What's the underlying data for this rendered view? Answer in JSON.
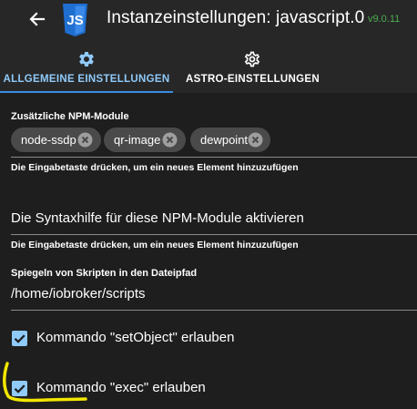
{
  "header": {
    "title": "Instanzeinstellungen: javascript.0",
    "version": "v9.0.11",
    "logo_text": "JS"
  },
  "icons": {
    "back": "arrow-left-icon",
    "logo": "javascript-logo-icon",
    "tab_general": "gear-icon",
    "tab_astro": "gear-outline-icon",
    "chip_delete": "cancel-circle-icon",
    "checkbox": "checkmark-icon"
  },
  "tabs": [
    {
      "label": "ALLGEMEINE EINSTELLUNGEN",
      "active": true
    },
    {
      "label": "ASTRO-EINSTELLUNGEN",
      "active": false
    }
  ],
  "npm": {
    "label": "Zusätzliche NPM-Module",
    "chips": [
      {
        "label": "node-ssdp"
      },
      {
        "label": "qr-image"
      },
      {
        "label": "dewpoint"
      }
    ],
    "helper": "Die Eingabetaste drücken, um ein neues Element hinzuzufügen"
  },
  "syntax": {
    "placeholder": "Die Syntaxhilfe für diese NPM-Module aktivieren",
    "helper": "Die Eingabetaste drücken, um ein neues Element hinzuzufügen"
  },
  "mirror": {
    "label": "Spiegeln von Skripten in den Dateipfad",
    "value": "/home/iobroker/scripts"
  },
  "checkboxes": [
    {
      "label": "Kommando \"setObject\" erlauben",
      "checked": true
    },
    {
      "label": "Kommando \"exec\" erlauben",
      "checked": true
    }
  ],
  "colors": {
    "background": "#1e1e1e",
    "header": "#272727",
    "accent": "#90caf9",
    "tab_indicator": "#3a8de6",
    "version": "#4caf50",
    "chip": "#4a4a4a",
    "js_logo": "#1f6fd0",
    "highlight": "#f2e600"
  }
}
